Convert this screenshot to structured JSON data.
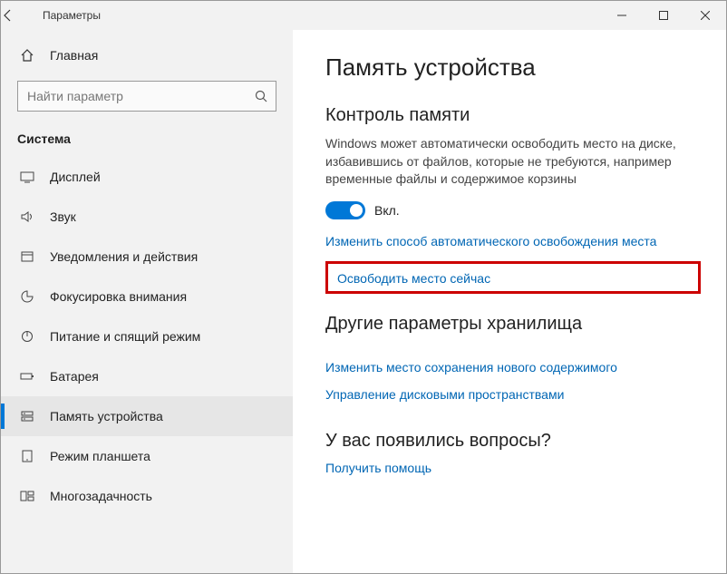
{
  "titlebar": {
    "title": "Параметры"
  },
  "sidebar": {
    "home": "Главная",
    "search_placeholder": "Найти параметр",
    "category": "Система",
    "items": [
      {
        "label": "Дисплей"
      },
      {
        "label": "Звук"
      },
      {
        "label": "Уведомления и действия"
      },
      {
        "label": "Фокусировка внимания"
      },
      {
        "label": "Питание и спящий режим"
      },
      {
        "label": "Батарея"
      },
      {
        "label": "Память устройства"
      },
      {
        "label": "Режим планшета"
      },
      {
        "label": "Многозадачность"
      }
    ]
  },
  "main": {
    "title": "Память устройства",
    "storage_sense": {
      "heading": "Контроль памяти",
      "description": "Windows может автоматически освободить место на диске, избавившись от файлов, которые не требуются, например временные файлы и содержимое корзины",
      "toggle_label": "Вкл.",
      "link_change": "Изменить способ автоматического освобождения места",
      "link_free_now": "Освободить место сейчас"
    },
    "other": {
      "heading": "Другие параметры хранилища",
      "link_save_locations": "Изменить место сохранения нового содержимого",
      "link_disk_spaces": "Управление дисковыми пространствами"
    },
    "help": {
      "heading": "У вас появились вопросы?",
      "link": "Получить помощь"
    }
  }
}
